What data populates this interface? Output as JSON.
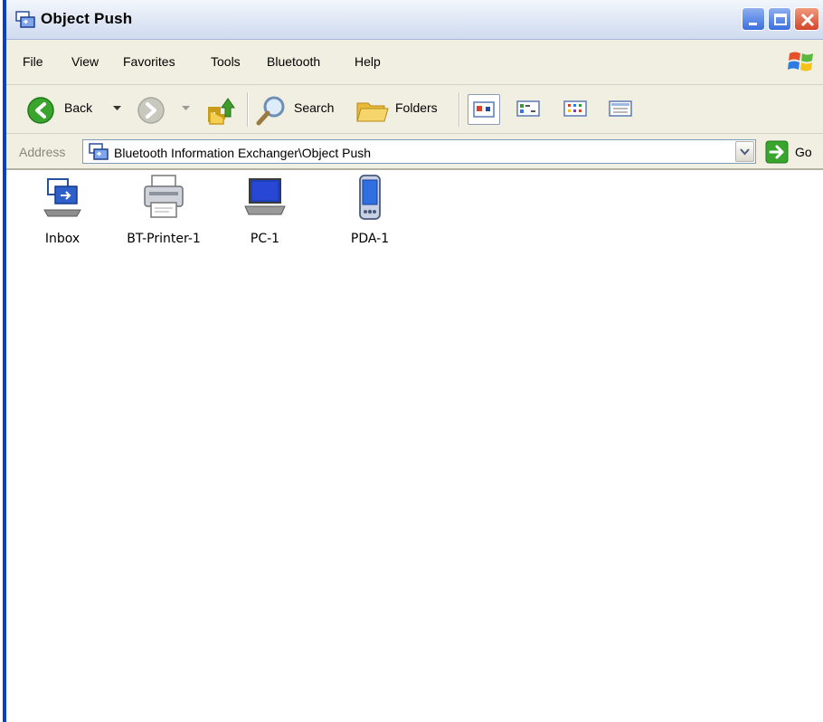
{
  "window": {
    "title": "Object Push"
  },
  "menu": {
    "items": [
      "File",
      "View",
      "Favorites",
      "Tools",
      "Bluetooth",
      "Help"
    ]
  },
  "toolbar": {
    "back_label": "Back",
    "search_label": "Search",
    "folders_label": "Folders"
  },
  "address": {
    "label": "Address",
    "value": "Bluetooth Information Exchanger\\Object Push",
    "go_label": "Go"
  },
  "items": [
    {
      "name": "Inbox",
      "icon": "inbox-icon"
    },
    {
      "name": "BT-Printer-1",
      "icon": "printer-icon"
    },
    {
      "name": "PC-1",
      "icon": "laptop-icon"
    },
    {
      "name": "PDA-1",
      "icon": "pda-icon"
    }
  ],
  "colors": {
    "titlebar": "#dde6f4",
    "toolbar": "#f1efe2",
    "close_button": "#d4452a",
    "accent": "#3a6fe0"
  }
}
